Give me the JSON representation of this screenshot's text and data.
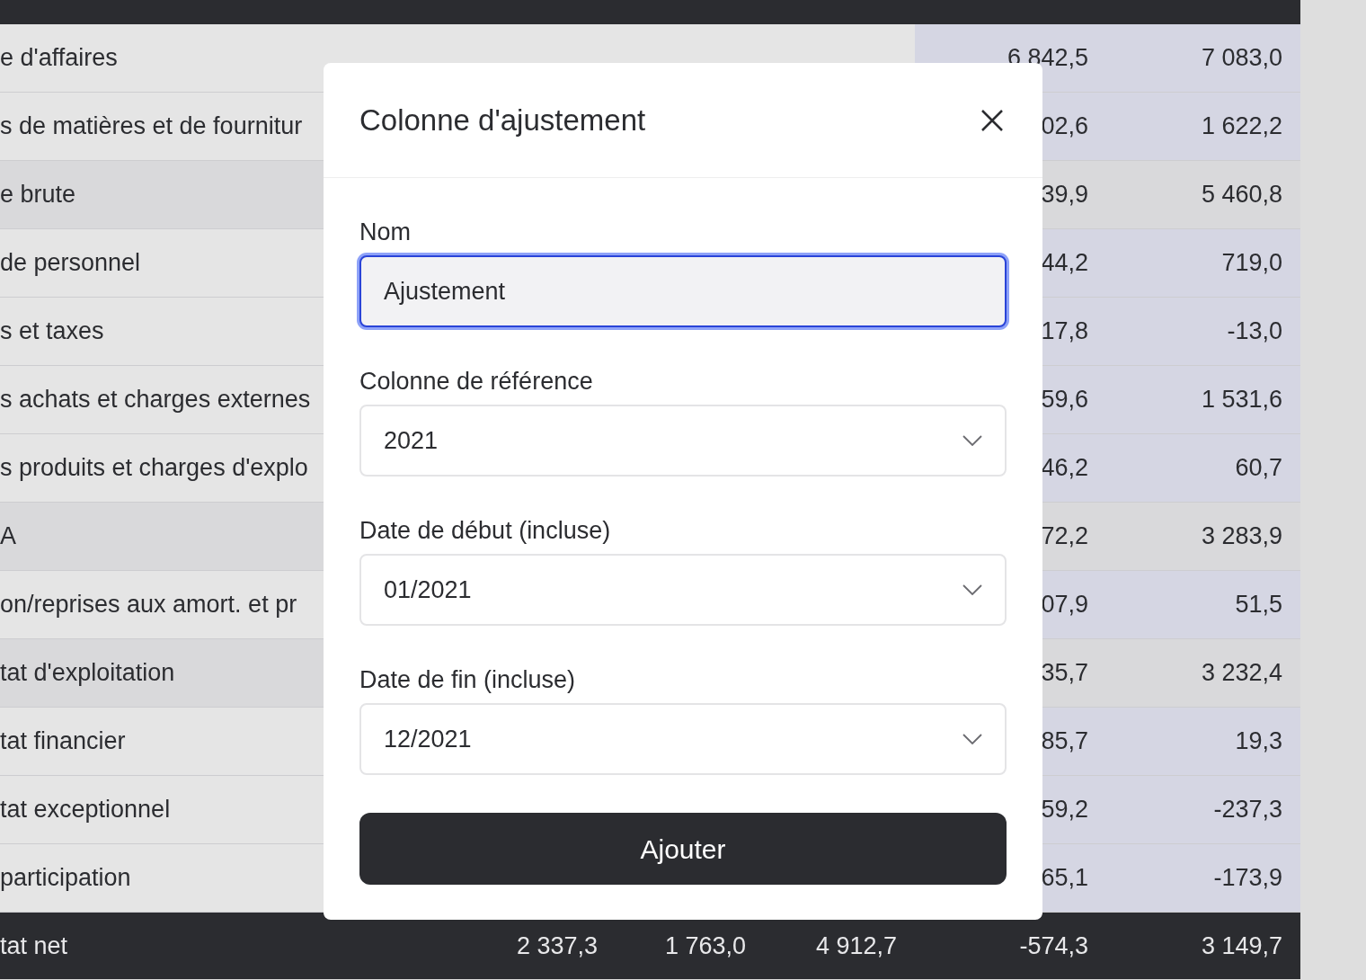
{
  "table": {
    "rows": [
      {
        "kind": "normal",
        "label": "e d'affaires",
        "values": [
          "6 842,5",
          "7 083,0"
        ]
      },
      {
        "kind": "normal",
        "label": "s de matières et de fournitur",
        "values": [
          "02,6",
          "1 622,2"
        ]
      },
      {
        "kind": "subtotal",
        "label": "e brute",
        "values": [
          "39,9",
          "5 460,8"
        ]
      },
      {
        "kind": "normal",
        "label": "de personnel",
        "values": [
          "44,2",
          "719,0"
        ]
      },
      {
        "kind": "normal",
        "label": "s et taxes",
        "values": [
          "17,8",
          "-13,0"
        ]
      },
      {
        "kind": "normal",
        "label": "s achats et charges externes",
        "values": [
          "59,6",
          "1 531,6"
        ]
      },
      {
        "kind": "normal",
        "label": "s produits et charges d'explo",
        "values": [
          "46,2",
          "60,7"
        ]
      },
      {
        "kind": "subtotal",
        "label": "A",
        "values": [
          "72,2",
          "3 283,9"
        ]
      },
      {
        "kind": "normal",
        "label": "on/reprises aux amort. et pr",
        "values": [
          "07,9",
          "51,5"
        ]
      },
      {
        "kind": "subtotal",
        "label": "tat d'exploitation",
        "values": [
          "35,7",
          "3 232,4"
        ]
      },
      {
        "kind": "normal",
        "label": "tat financier",
        "values": [
          "85,7",
          "19,3"
        ]
      },
      {
        "kind": "normal",
        "label": "tat exceptionnel",
        "values": [
          "59,2",
          "-237,3"
        ]
      },
      {
        "kind": "normal",
        "label": "participation",
        "values": [
          "65,1",
          "-173,9"
        ]
      },
      {
        "kind": "total",
        "label": "tat net",
        "values": [
          "2 337,3",
          "1 763,0",
          "4 912,7",
          "-574,3",
          "3 149,7"
        ]
      }
    ]
  },
  "dialog": {
    "title": "Colonne d'ajustement",
    "fields": [
      {
        "kind": "text",
        "label": "Nom",
        "value": "Ajustement",
        "focused": true
      },
      {
        "kind": "select",
        "label": "Colonne de référence",
        "value": "2021",
        "focused": false
      },
      {
        "kind": "select",
        "label": "Date de début (incluse)",
        "value": "01/2021",
        "focused": false
      },
      {
        "kind": "select",
        "label": "Date de fin (incluse)",
        "value": "12/2021",
        "focused": false
      }
    ],
    "button": "Ajouter"
  }
}
